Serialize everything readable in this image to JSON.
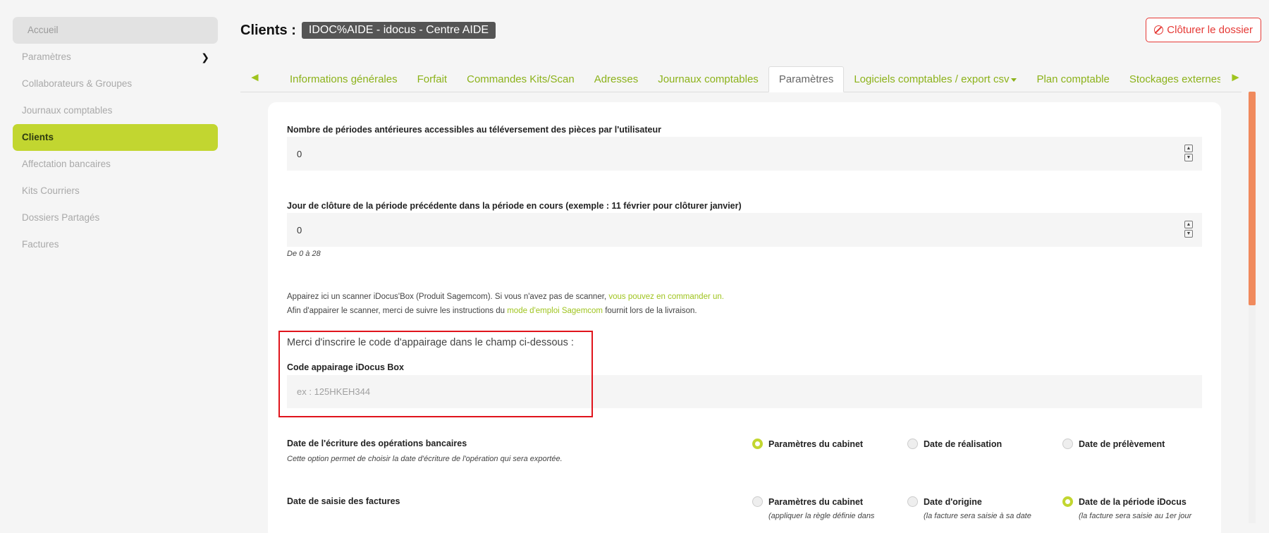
{
  "sidebar": {
    "items": [
      {
        "label": "Accueil"
      },
      {
        "label": "Paramètres"
      },
      {
        "label": "Collaborateurs & Groupes"
      },
      {
        "label": "Journaux comptables"
      },
      {
        "label": "Clients"
      },
      {
        "label": "Affectation bancaires"
      },
      {
        "label": "Kits Courriers"
      },
      {
        "label": "Dossiers Partagés"
      },
      {
        "label": "Factures"
      }
    ]
  },
  "header": {
    "title": "Clients :",
    "client_badge": "IDOC%AIDE - idocus - Centre AIDE",
    "close_button": "Clôturer le dossier"
  },
  "tabs": {
    "left_arrow": "◄",
    "right_arrow": "►",
    "items": [
      {
        "label": "Informations générales"
      },
      {
        "label": "Forfait"
      },
      {
        "label": "Commandes Kits/Scan"
      },
      {
        "label": "Adresses"
      },
      {
        "label": "Journaux comptables"
      },
      {
        "label": "Paramètres"
      },
      {
        "label": "Logiciels comptables / export csv"
      },
      {
        "label": "Plan comptable"
      },
      {
        "label": "Stockages externes"
      }
    ]
  },
  "form": {
    "periods_label": "Nombre de périodes antérieures accessibles au téléversement des pièces par l'utilisateur",
    "periods_value": "0",
    "closing_day_label": "Jour de clôture de la période précédente dans la période en cours (exemple : 11 février pour clôturer janvier)",
    "closing_day_value": "0",
    "closing_day_hint": "De 0 à 28",
    "scanner_text_1": "Appairez ici un scanner iDocus'Box (Produit Sagemcom). Si vous n'avez pas de scanner,",
    "scanner_link_1": "vous pouvez en commander un.",
    "scanner_text_2": "Afin d'appairer le scanner, merci de suivre les instructions du",
    "scanner_link_2": "mode d'emploi Sagemcom",
    "scanner_text_3": "fournit lors de la livraison.",
    "pairing_title": "Merci d'inscrire le code d'appairage dans le champ ci-dessous :",
    "pairing_label": "Code appairage iDocus Box",
    "pairing_placeholder": "ex : 125HKEH344",
    "bank_date_label": "Date de l'écriture des opérations bancaires",
    "bank_date_hint": "Cette option permet de choisir la date d'écriture de l'opération qui sera exportée.",
    "bank_options": [
      {
        "label": "Paramètres du cabinet",
        "selected": true
      },
      {
        "label": "Date de réalisation",
        "selected": false
      },
      {
        "label": "Date de prélèvement",
        "selected": false
      }
    ],
    "invoice_date_label": "Date de saisie des factures",
    "invoice_options": [
      {
        "label": "Paramètres du cabinet",
        "selected": false,
        "sub": "(appliquer la règle définie dans"
      },
      {
        "label": "Date d'origine",
        "selected": false,
        "sub": "(la facture sera saisie à sa date"
      },
      {
        "label": "Date de la période iDocus",
        "selected": true,
        "sub": "(la facture sera saisie au 1er jour"
      }
    ]
  },
  "colors": {
    "accent": "#c2d630",
    "link": "#8cb21a",
    "danger": "#e53935",
    "scroll_thumb": "#f08a5d"
  }
}
